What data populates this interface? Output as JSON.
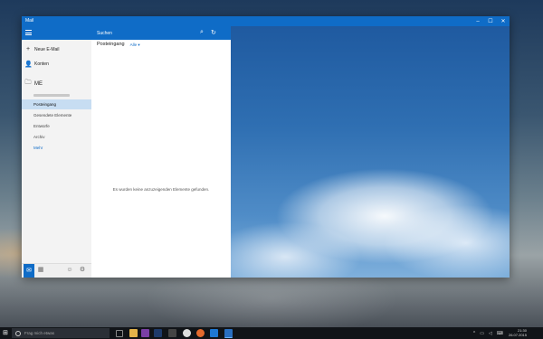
{
  "window": {
    "title": "Mail",
    "minimize": "–",
    "maximize": "☐",
    "close": "✕"
  },
  "nav": {
    "new_mail": "Neue E-Mail",
    "accounts": "Konten",
    "account_name": "ME",
    "folders": [
      "Posteingang",
      "Gesendete Elemente",
      "Entwürfe",
      "Archiv"
    ],
    "more": "Mehr"
  },
  "list": {
    "search_placeholder": "Suchen",
    "folder_title": "Posteingang",
    "filter": "Alle ▾",
    "empty_message": "Es wurden keine anzuzeigenden Elemente gefunden."
  },
  "taskbar": {
    "search_placeholder": "Frag mich etwas",
    "time": "21:30",
    "date": "26.07.2015"
  },
  "colors": {
    "accent": "#0f6cc7",
    "selected_folder": "#c7ddf2"
  }
}
